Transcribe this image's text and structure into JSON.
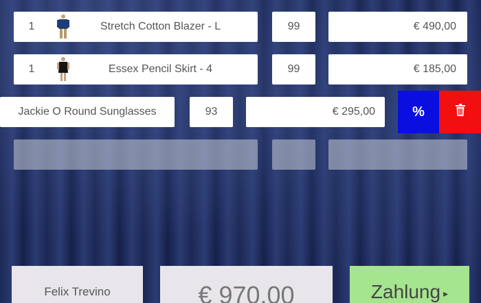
{
  "cart": {
    "items": [
      {
        "index": "1",
        "name": "Stretch Cotton Blazer - L",
        "qty": "99",
        "price": "€ 490,00",
        "thumb": "blazer-product-image"
      },
      {
        "index": "1",
        "name": "Essex Pencil Skirt - 4",
        "qty": "99",
        "price": "€ 185,00",
        "thumb": "skirt-product-image"
      }
    ],
    "selected": {
      "name": "Jackie O Round Sunglasses",
      "qty": "93",
      "price": "€ 295,00"
    },
    "actions": {
      "discount_label": "%",
      "delete_icon": "trash-icon"
    }
  },
  "footer": {
    "customer": "Felix Trevino",
    "total": "€ 970,00",
    "pay_label": "Zahlung",
    "pay_arrow": "▸"
  },
  "colors": {
    "discount": "#0a0fe0",
    "delete": "#f20f10",
    "pay": "#a5e58d"
  }
}
